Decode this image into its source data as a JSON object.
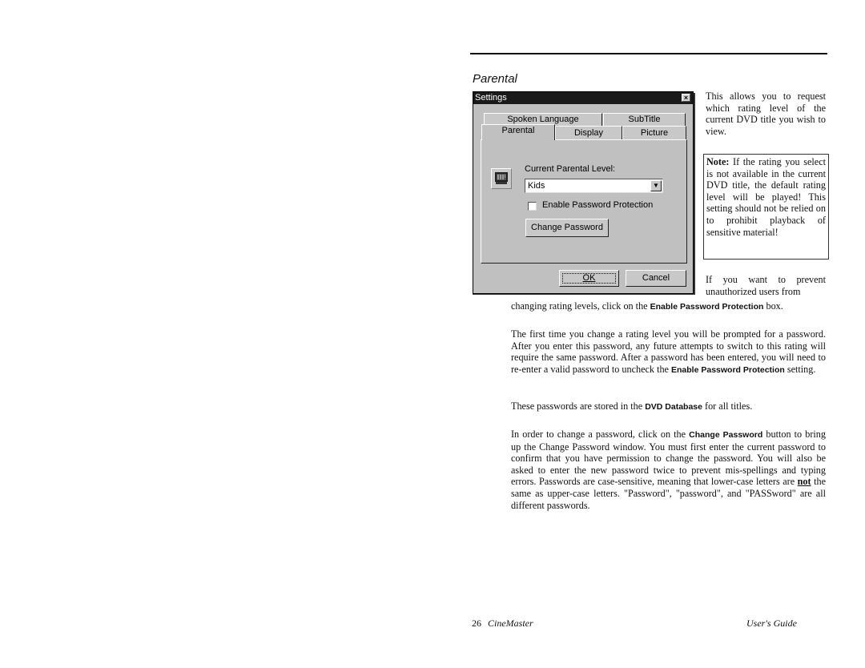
{
  "section_title": "Parental",
  "dialog": {
    "title": "Settings",
    "close_glyph": "×",
    "tabs_row1": [
      {
        "label": "Spoken Language"
      },
      {
        "label": "SubTitle"
      }
    ],
    "tabs_row2": [
      {
        "label": "Parental",
        "active": true
      },
      {
        "label": "Display"
      },
      {
        "label": "Picture"
      }
    ],
    "icon": "monitor-icon",
    "level_label": "Current Parental Level:",
    "level_value": "Kids",
    "dropdown_glyph": "▼",
    "checkbox_label": "Enable Password Protection",
    "checkbox_checked": false,
    "change_password_label": "Change Password",
    "ok_label": "OK",
    "cancel_label": "Cancel"
  },
  "text": {
    "intro": "This allows you to request which rating level of the current DVD title you wish to view.",
    "note_label": "Note:",
    "note_body": " If the rating you select is not available in the current DVD title, the default rating level will be played!  This setting should not be relied on to prohibit playback of sensitive material!",
    "prevent_1": "If you want to prevent",
    "prevent_2": "unauthorized users from",
    "click_pre": "changing rating levels, click on the ",
    "click_ui": "Enable Password Protection",
    "click_post": " box.",
    "first_body": "The first time you change a rating level you will be prompted for a password.  After you enter this password, any future attempts to switch to this rating will require the same password.  After a password has been entered, you will need to re-enter a valid password to uncheck the ",
    "first_ui": "Enable Password Protection",
    "first_post": " setting.",
    "stored_pre": "These passwords are stored in the ",
    "stored_ui": "DVD Database",
    "stored_post": " for all titles.",
    "change_pre": "In order to change a password, click on the ",
    "change_ui": "Change Password",
    "change_mid": " button to bring up the Change Password window.  You must first enter the current password to confirm that you have permission to change the password.  You will also be asked to enter the new password twice to prevent mis-spellings and typing errors.  Passwords are case-sensitive, meaning that lower-case letters are ",
    "change_not": "not",
    "change_post": " the same as upper-case letters. \"Password\", \"password\", and \"PASSword\" are all different passwords."
  },
  "footer": {
    "page_number": "26",
    "book_title": "CineMaster",
    "guide": "User's Guide"
  }
}
